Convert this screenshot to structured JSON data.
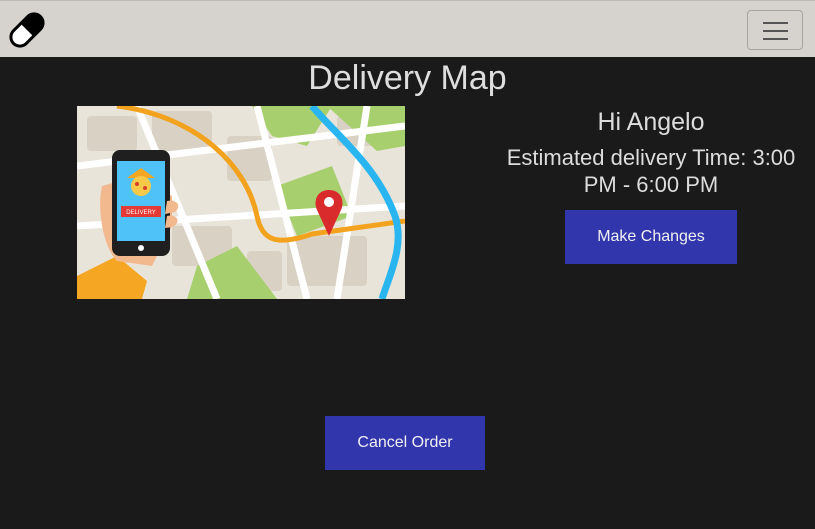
{
  "navbar": {
    "logo_icon": "capsule-pill-icon",
    "menu_icon": "hamburger-menu-icon"
  },
  "page": {
    "title": "Delivery Map"
  },
  "map_image": {
    "icon": "delivery-map-illustration",
    "phone_label": "DELIVERY"
  },
  "info": {
    "greeting": "Hi Angelo",
    "eta": "Estimated delivery Time: 3:00 PM - 6:00 PM"
  },
  "actions": {
    "make_changes_label": "Make Changes",
    "cancel_order_label": "Cancel Order"
  },
  "colors": {
    "navbar_bg": "#d6d3cf",
    "page_bg": "#1a1a1a",
    "button_bg": "#3236ad"
  }
}
